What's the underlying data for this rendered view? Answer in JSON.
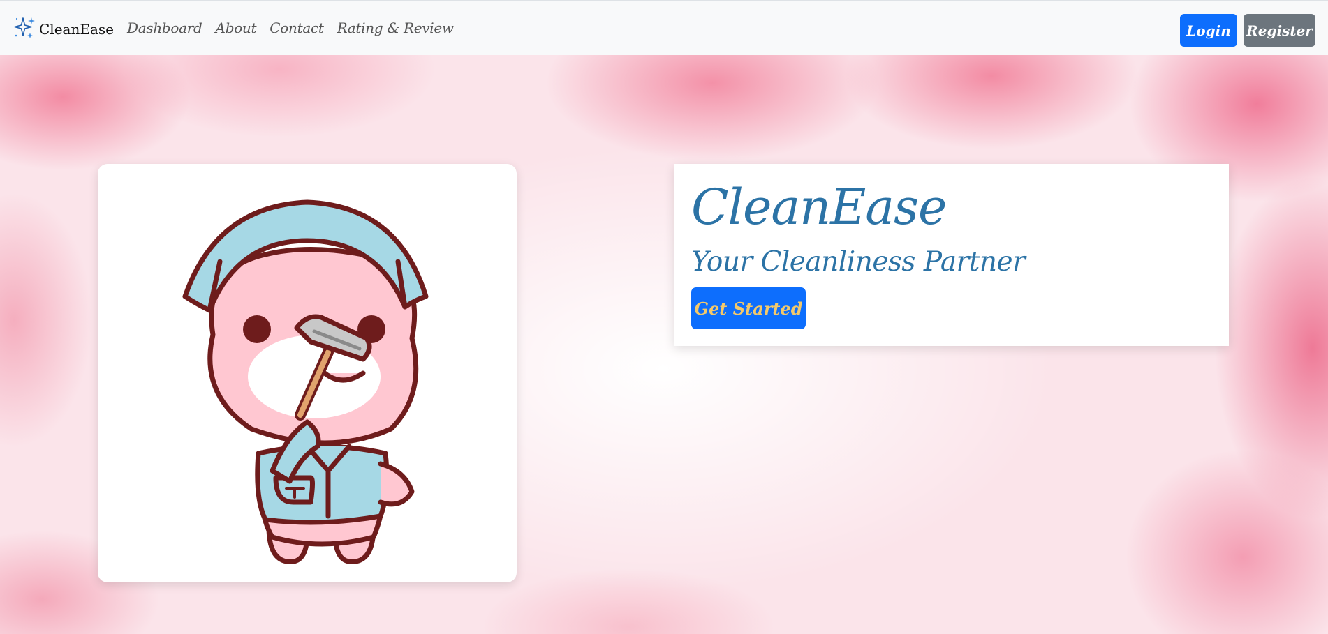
{
  "navbar": {
    "brand": {
      "icon": "sparkles-icon",
      "name": "CleanEase"
    },
    "links": [
      {
        "label": "Dashboard"
      },
      {
        "label": "About"
      },
      {
        "label": "Contact"
      },
      {
        "label": "Rating & Review"
      }
    ],
    "login_label": "Login",
    "register_label": "Register"
  },
  "hero": {
    "title": "CleanEase",
    "subtitle": "Your Cleanliness Partner",
    "cta_label": "Get Started",
    "mascot": "cleaner-mascot-illustration"
  },
  "colors": {
    "primary": "#0d6efd",
    "secondary": "#6c757d",
    "title_blue": "#2c73a6",
    "cta_text": "#f3c96b",
    "cloud_pink": "#f06e8c",
    "navbar_bg": "#f8f9fa"
  }
}
